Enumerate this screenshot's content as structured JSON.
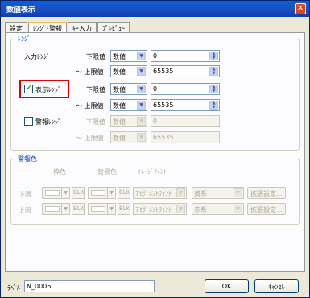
{
  "window": {
    "title": "数値表示",
    "close_glyph": "✕"
  },
  "tabs": [
    {
      "label": "設定"
    },
    {
      "label": "ﾚﾝｼﾞ･警報"
    },
    {
      "label": "ｷｰ入力"
    },
    {
      "label": "ﾌﾟﾚﾋﾞｭｰ"
    }
  ],
  "range_group": {
    "legend": "ﾚﾝｼﾞ",
    "input_range_label": "入力ﾚﾝｼﾞ",
    "display_range_label": "表示ﾚﾝｼﾞ",
    "display_range_checked": true,
    "alarm_range_label": "警報ﾚﾝｼﾞ",
    "alarm_range_checked": false,
    "lower_label": "下限値",
    "upper_label": "～ 上限値",
    "type_value": "数値",
    "input_lower": "0",
    "input_upper": "65535",
    "display_lower": "0",
    "display_upper": "65535",
    "alarm_lower": "0",
    "alarm_upper": "65535"
  },
  "alarm_color_group": {
    "legend": "警報色",
    "col_char": "枠色",
    "col_bg": "背景色",
    "col_image": "ｲﾒｰｼﾞﾌｫﾝﾄ",
    "rows": [
      {
        "label": "下限",
        "blk": "BLK",
        "blk2": "BLK",
        "font": "7ｾｸﾞﾒﾝﾄﾌｫﾝﾄ",
        "color_name": "黄系",
        "detail": "拡張設定..."
      },
      {
        "label": "上限",
        "blk": "BLK",
        "blk2": "BLK",
        "font": "7ｾｸﾞﾒﾝﾄﾌｫﾝﾄ",
        "color_name": "赤系",
        "detail": "拡張設定..."
      }
    ]
  },
  "bottom": {
    "label_caption": "ﾗﾍﾞﾙ",
    "label_value": "N_0006",
    "ok": "OK",
    "cancel": "ｷｬﾝｾﾙ"
  },
  "colors": {
    "legend": "#0046d5",
    "highlight": "#e00000",
    "title_bar": "#0a5fd8"
  }
}
